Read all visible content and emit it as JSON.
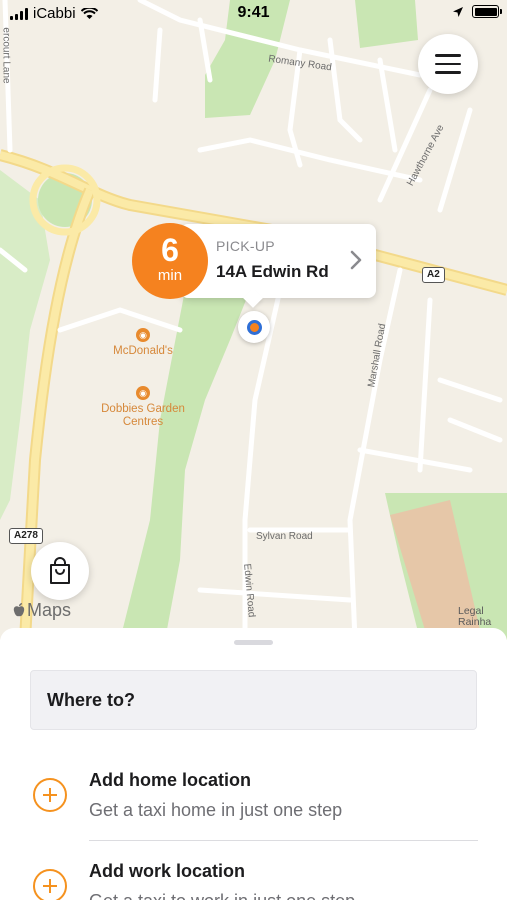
{
  "status_bar": {
    "carrier": "iCabbi",
    "time": "9:41"
  },
  "map": {
    "street_labels": {
      "romany_road": "Romany Road",
      "hawthorne_ave": "Hawthorne Ave",
      "marshall_road": "Marshall Road",
      "sylvan_road": "Sylvan Road",
      "edwin_road": "Edwin Road",
      "court_lane": "ercourt Lane"
    },
    "road_shields": {
      "a2": "A2",
      "a278": "A278"
    },
    "pois": {
      "mcdonalds": "McDonald's",
      "dobbies_line1": "Dobbies Garden",
      "dobbies_line2": "Centres"
    },
    "attribution": "Maps",
    "legal_line1": "Legal",
    "legal_line2": "Rainha"
  },
  "pickup": {
    "eta_value": "6",
    "eta_unit": "min",
    "label": "PICK-UP",
    "address": "14A Edwin Rd"
  },
  "sheet": {
    "search_placeholder": "Where to?",
    "items": [
      {
        "title": "Add home location",
        "subtitle": "Get a taxi home in just one step"
      },
      {
        "title": "Add work location",
        "subtitle": "Get a taxi to work in just one step"
      }
    ]
  },
  "colors": {
    "accent": "#f5821f",
    "map_background": "#f3efe6",
    "park_green": "#cfe8b9",
    "location_blue": "#2f6fd6"
  }
}
